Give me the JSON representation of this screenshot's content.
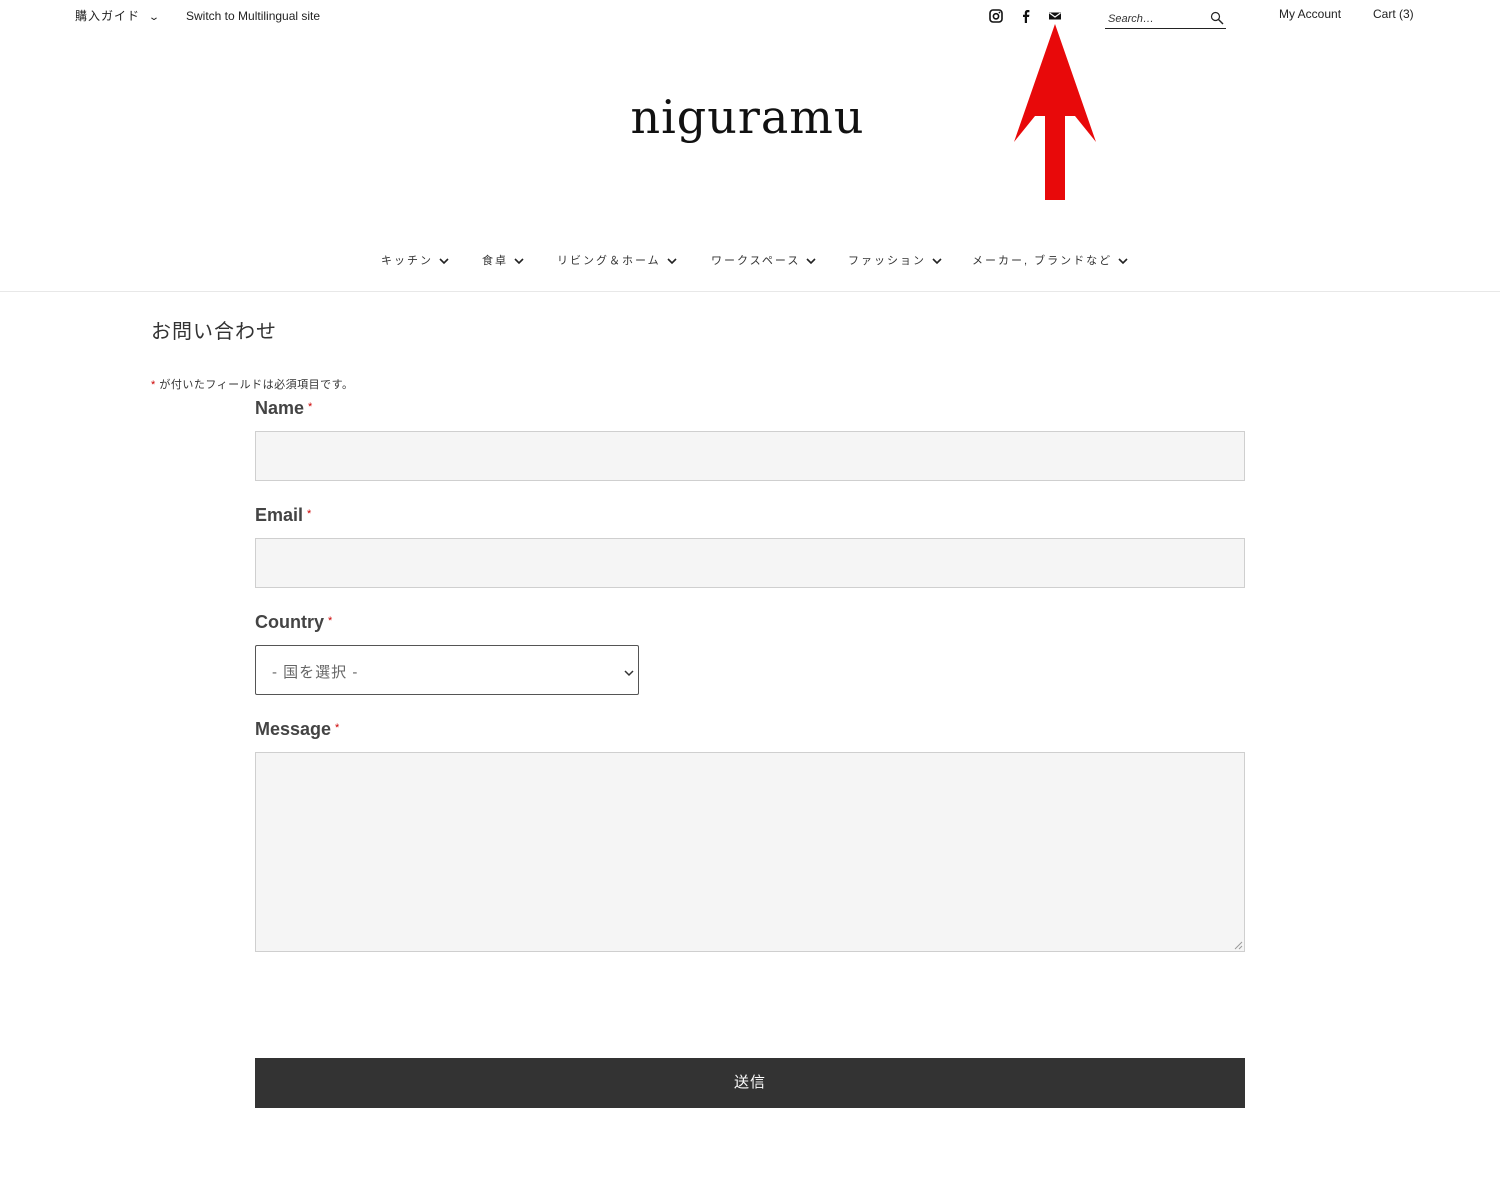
{
  "topbar": {
    "guide_label": "購入ガイド",
    "switch_label": "Switch to Multilingual site",
    "social": [
      "instagram-icon",
      "facebook-icon",
      "mail-icon"
    ],
    "search_placeholder": "Search…",
    "account_label": "My Account",
    "cart_label": "Cart (3)"
  },
  "logo": "niguramu",
  "nav": {
    "items": [
      {
        "label": "キッチン"
      },
      {
        "label": "食卓"
      },
      {
        "label": "リビング＆ホーム"
      },
      {
        "label": "ワークスペース"
      },
      {
        "label": "ファッション"
      },
      {
        "label": "メーカー, ブランドなど"
      }
    ]
  },
  "page": {
    "title": "お問い合わせ",
    "required_star": "*",
    "required_note": "が付いたフィールドは必須項目です。"
  },
  "form": {
    "name_label": "Name",
    "email_label": "Email",
    "country_label": "Country",
    "country_value": "- 国を選択 -",
    "message_label": "Message",
    "required_mark": "*",
    "submit_label": "送信"
  },
  "colors": {
    "annotation_arrow": "#e8090a",
    "submit_bg": "#333333",
    "required": "#cc0000"
  }
}
